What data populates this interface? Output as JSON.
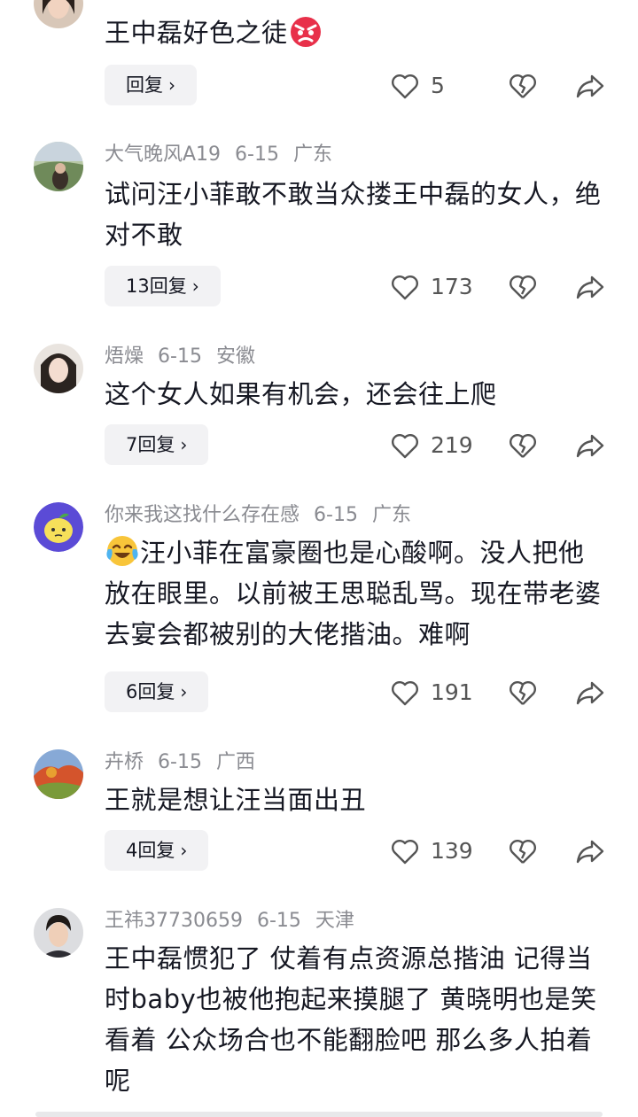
{
  "comments": [
    {
      "avatar": "woman-portrait-avatar",
      "username": "",
      "date": "",
      "location": "",
      "text": "王中磊好色之徒",
      "emoji": "angry-face-emoji",
      "reply_label": "回复",
      "likes": "5"
    },
    {
      "avatar": "landscape-avatar",
      "username": "大气晚风A19",
      "date": "6-15",
      "location": "广东",
      "text": "试问汪小菲敢不敢当众搂王中磊的女人，绝对不敢",
      "reply_label": "13回复",
      "likes": "173"
    },
    {
      "avatar": "girl-portrait-avatar",
      "username": "焐燥",
      "date": "6-15",
      "location": "安徽",
      "text": "这个女人如果有机会，还会往上爬",
      "reply_label": "7回复",
      "likes": "219"
    },
    {
      "avatar": "lemon-cartoon-avatar",
      "username": "你来我这找什么存在感",
      "date": "6-15",
      "location": "广东",
      "text": "汪小菲在富豪圈也是心酸啊。没人把他放在眼里。以前被王思聪乱骂。现在带老婆去宴会都被别的大佬揩油。难啊",
      "emoji": "crying-laughing-emoji",
      "reply_label": "6回复",
      "likes": "191"
    },
    {
      "avatar": "autumn-trees-avatar",
      "username": "卉桥",
      "date": "6-15",
      "location": "广西",
      "text": "王就是想让汪当面出丑",
      "reply_label": "4回复",
      "likes": "139"
    },
    {
      "avatar": "man-portrait-avatar",
      "username": "王祎37730659",
      "date": "6-15",
      "location": "天津",
      "text": "王中磊惯犯了 仗着有点资源总揩油 记得当时baby也被他抱起来摸腿了 黄晓明也是笑看着 公众场合也不能翻脸吧 那么多人拍着呢"
    }
  ],
  "icons": {
    "like": "heart-outline-icon",
    "dislike": "broken-heart-icon",
    "share": "share-arrow-icon",
    "chevron": "chevron-right-icon"
  },
  "colors": {
    "meta": "#8a8b91",
    "text": "#161823",
    "reply_bg": "#f2f2f4"
  }
}
